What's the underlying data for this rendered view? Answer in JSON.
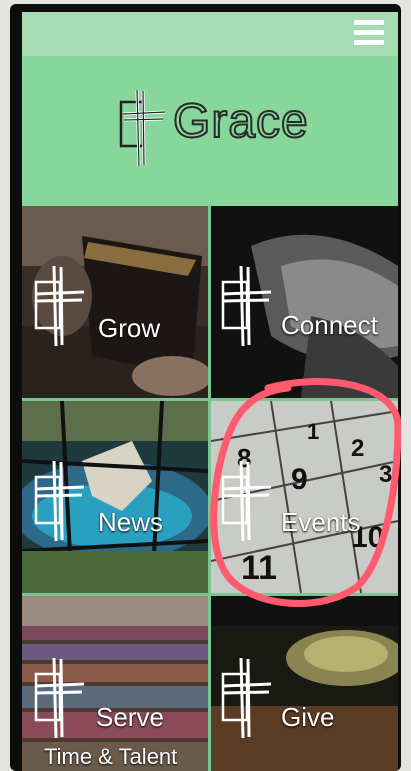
{
  "header": {
    "title": "Grace",
    "menu_icon": "hamburger-menu-icon",
    "background": "#87d79d",
    "top_bar_color": "#a6dcb2"
  },
  "tiles": [
    {
      "label": "Grow",
      "image": "holy-bible-hands"
    },
    {
      "label": "Connect",
      "image": "praying-hands"
    },
    {
      "label": "News",
      "image": "stained-glass-dove"
    },
    {
      "label": "Events",
      "image": "calendar-page"
    },
    {
      "label": "Serve",
      "sublabel": "Time & Talent",
      "image": "church-pews-quilts"
    },
    {
      "label": "Give",
      "image": "offering-plate"
    }
  ],
  "calendar_numbers": [
    "1",
    "2",
    "3",
    "8",
    "9",
    "10",
    "11"
  ],
  "annotation": {
    "color": "#ff5a6e",
    "target": "Events"
  },
  "accent_color": "#7bc493"
}
